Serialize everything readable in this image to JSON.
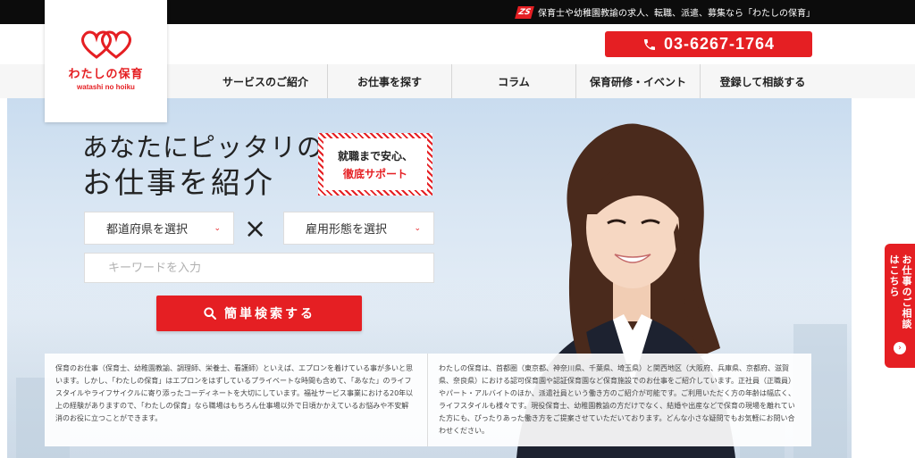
{
  "topbar": {
    "mark": "ZS",
    "text": "保育士や幼稚園教諭の求人、転職、派遣、募集なら「わたしの保育」"
  },
  "header": {
    "phone": "03-6267-1764"
  },
  "logo": {
    "name": "わたしの保育",
    "sub": "watashi no hoiku"
  },
  "nav": {
    "items": [
      "サービスのご紹介",
      "お仕事を探す",
      "コラム",
      "保育研修・イベント",
      "登録して相談する"
    ]
  },
  "hero": {
    "headline_1": "あなたにピッタリの",
    "headline_2": "お仕事を紹介",
    "badge_1": "就職まで安心、",
    "badge_2": "徹底サポート",
    "select_pref": "都道府県を選択",
    "times": "×",
    "select_type": "雇用形態を選択",
    "keyword_placeholder": "キーワードを入力",
    "search_label": "簡単検索する"
  },
  "info": {
    "left": "保育のお仕事（保育士、幼稚園教諭、調理師、栄養士、看護師）といえば、エプロンを着けている事が多いと思います。しかし、「わたしの保育」はエプロンをはずしているプライベートな時間も含めて、「あなた」のライフスタイルやライフサイクルに寄り添ったコーディネートを大切にしています。福祉サービス事業における20年以上の経験がありますので、「わたしの保育」なら職場はもちろん仕事場以外で日頃かかえているお悩みや不安解消のお役に立つことができます。",
    "right": "わたしの保育は、首都圏（東京都、神奈川県、千葉県、埼玉県）と関西地区（大阪府、兵庫県、京都府、滋賀県、奈良県）における認可保育園や認証保育園など保育施設でのお仕事をご紹介しています。正社員（正職員）やパート・アルバイトのほか、派遣社員という働き方のご紹介が可能です。ご利用いただく方の年齢は幅広く、ライフスタイルも様々です。現役保育士、幼稚園教諭の方だけでなく、結婚や出産などで保育の現場を離れていた方にも、ぴったりあった働き方をご提案させていただいております。どんな小さな疑問でもお気軽にお問い合わせください。"
  },
  "side_tab": {
    "label": "お仕事のご相談はこちら",
    "arrow": "›"
  },
  "colors": {
    "brand_red": "#e51f23",
    "topbar": "#0c0c0c",
    "nav_bg": "#f6f6f6"
  }
}
